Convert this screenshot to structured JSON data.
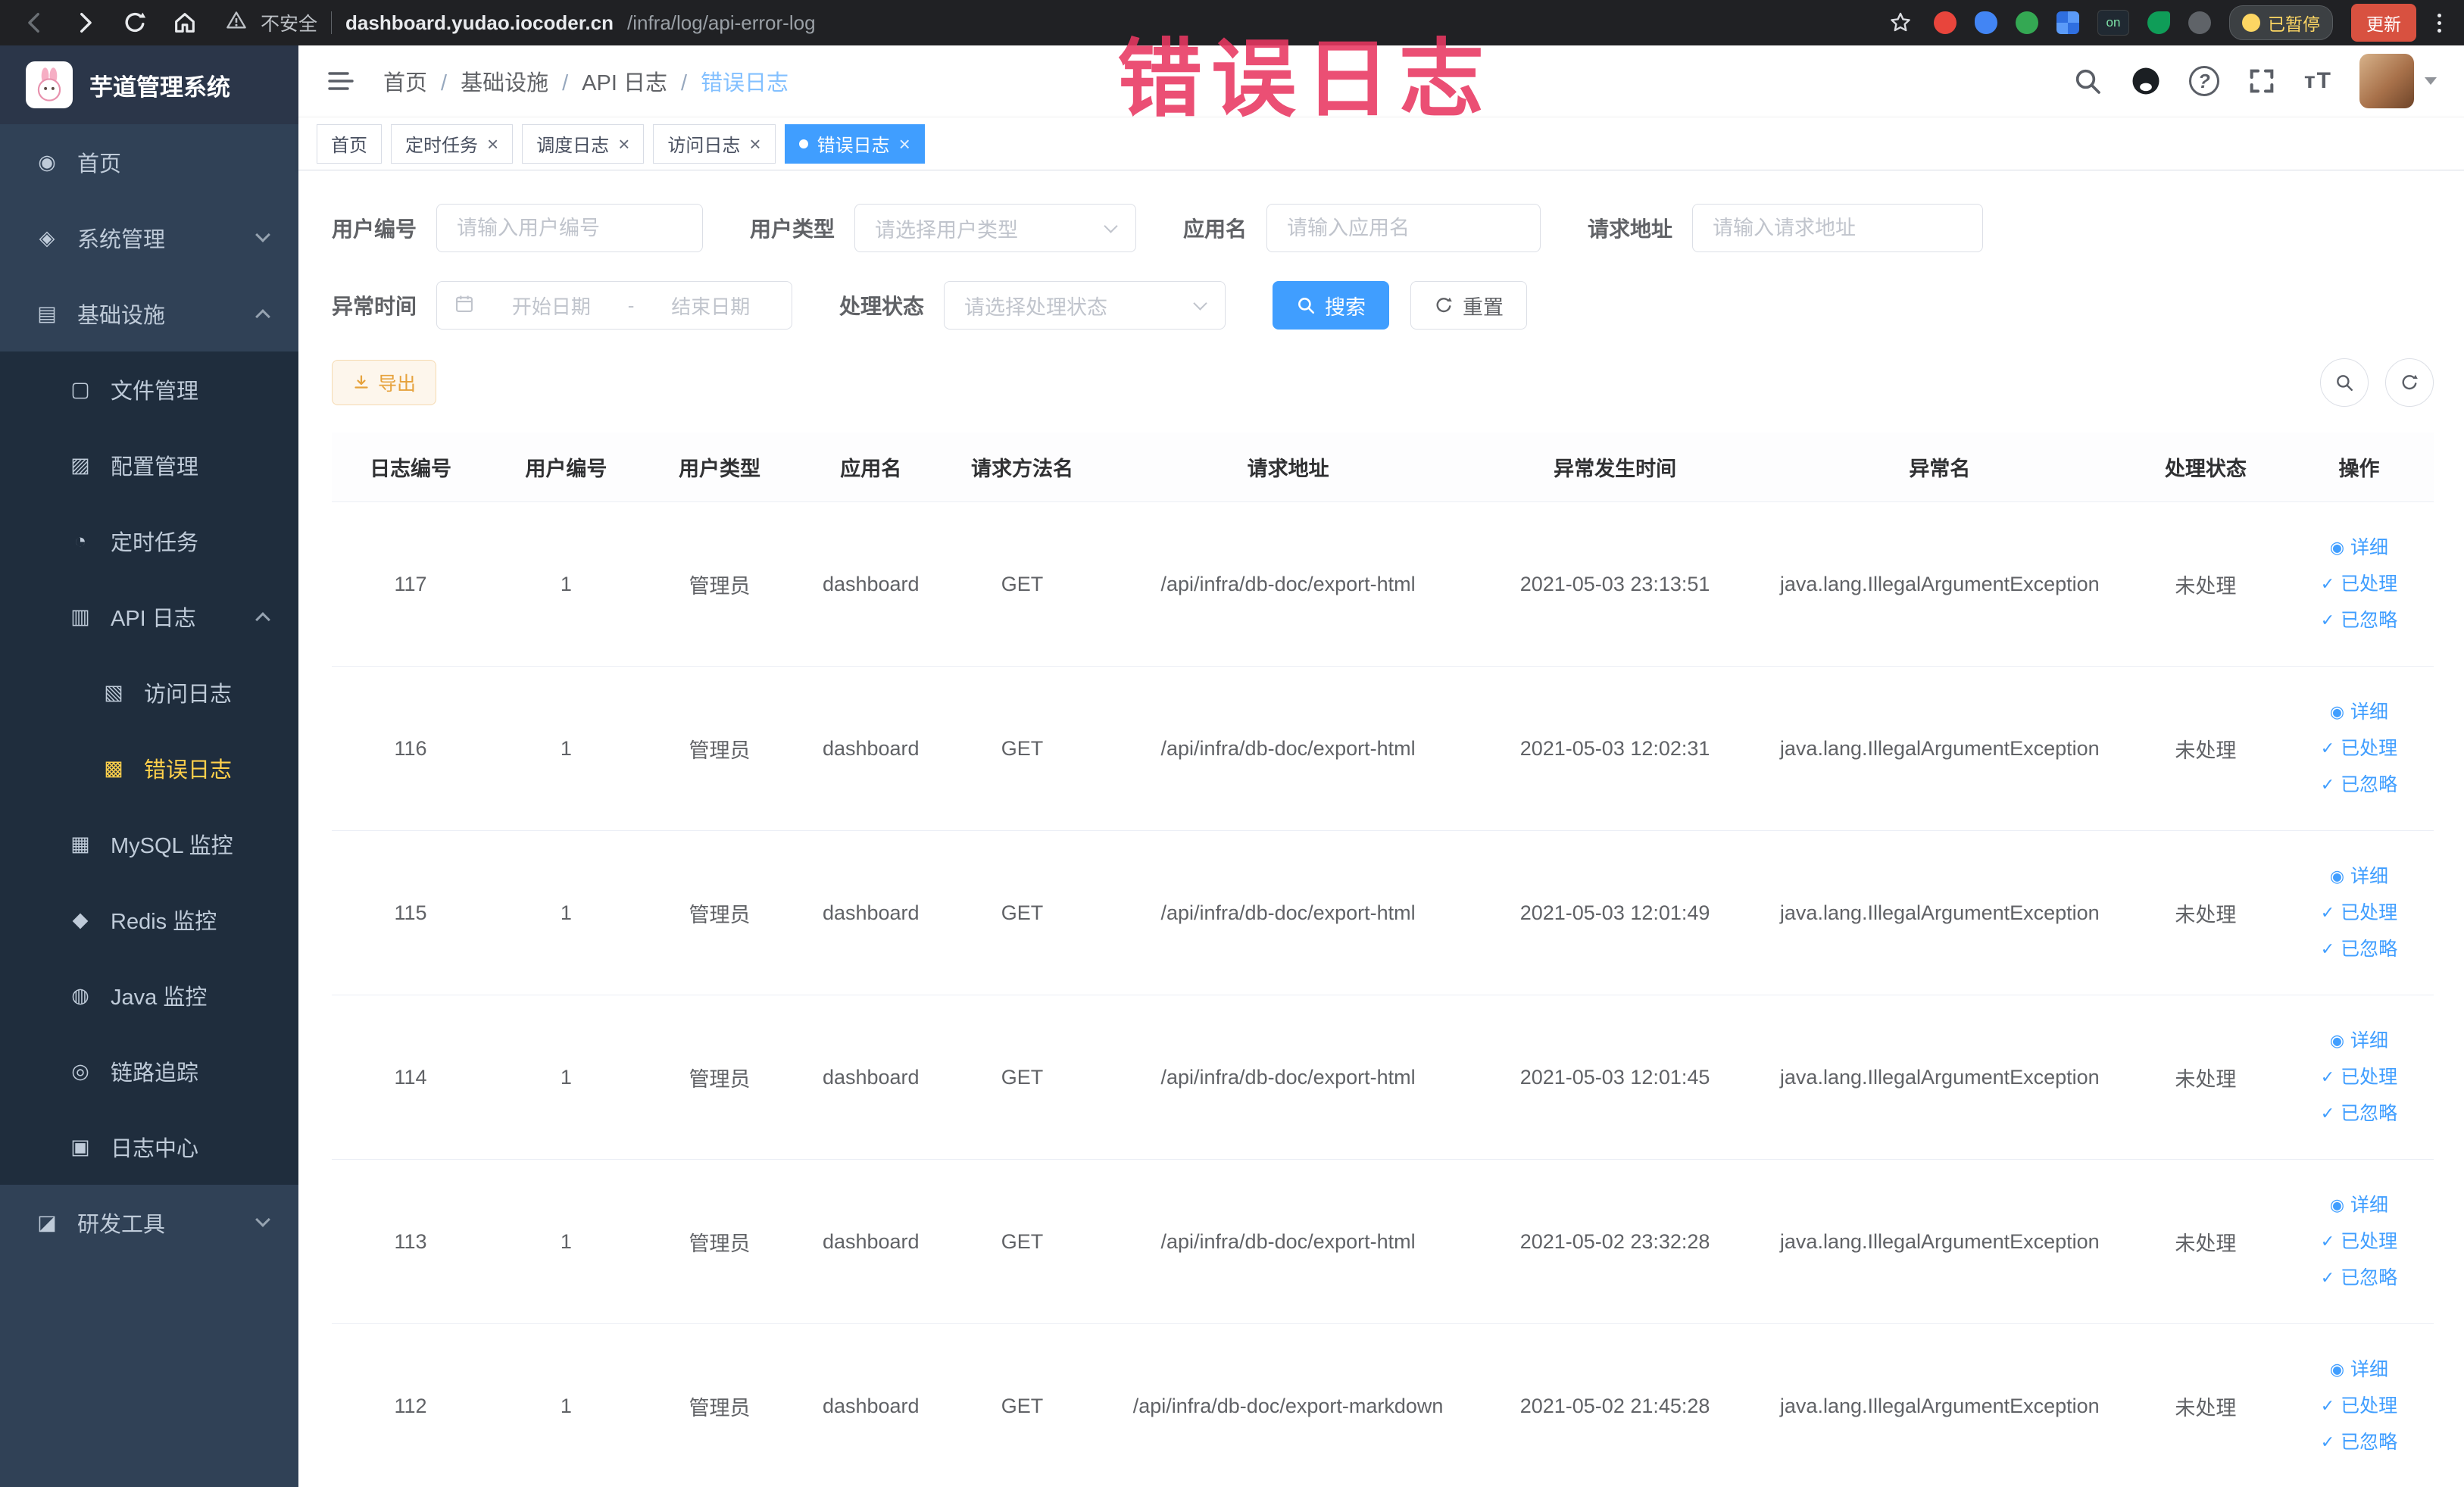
{
  "browser": {
    "security_label": "不安全",
    "url_host": "dashboard.yudao.iocoder.cn",
    "url_path": "/infra/log/api-error-log",
    "ext_on_label": "on",
    "paused_label": "已暂停",
    "update_label": "更新"
  },
  "watermark_text": "错误日志",
  "icons": {
    "close": "×",
    "question": "?",
    "font_size": "тT"
  },
  "sidebar": {
    "app_title": "芋道管理系统",
    "items": [
      {
        "label": "首页",
        "icon": "◉",
        "cls": "l0"
      },
      {
        "label": "系统管理",
        "icon": "◈",
        "cls": "l0",
        "arrow": "down"
      },
      {
        "label": "基础设施",
        "icon": "▤",
        "cls": "l0",
        "arrow": "up"
      },
      {
        "label": "文件管理",
        "icon": "▢",
        "cls": "l1"
      },
      {
        "label": "配置管理",
        "icon": "▨",
        "cls": "l1"
      },
      {
        "label": "定时任务",
        "icon": "◔",
        "cls": "l1"
      },
      {
        "label": "API 日志",
        "icon": "▥",
        "cls": "l1",
        "arrow": "up"
      },
      {
        "label": "访问日志",
        "icon": "▧",
        "cls": "l2"
      },
      {
        "label": "错误日志",
        "icon": "▩",
        "cls": "l2 active"
      },
      {
        "label": "MySQL 监控",
        "icon": "▦",
        "cls": "l1"
      },
      {
        "label": "Redis 监控",
        "icon": "◆",
        "cls": "l1"
      },
      {
        "label": "Java 监控",
        "icon": "◍",
        "cls": "l1"
      },
      {
        "label": "链路追踪",
        "icon": "◎",
        "cls": "l1"
      },
      {
        "label": "日志中心",
        "icon": "▣",
        "cls": "l1"
      },
      {
        "label": "研发工具",
        "icon": "◪",
        "cls": "l0",
        "arrow": "down"
      }
    ]
  },
  "header": {
    "breadcrumb": [
      {
        "label": "首页",
        "cls": ""
      },
      {
        "label": "基础设施",
        "cls": ""
      },
      {
        "label": "API 日志",
        "cls": ""
      },
      {
        "label": "错误日志",
        "cls": "current"
      }
    ]
  },
  "tabs": [
    {
      "label": "首页",
      "cls": "no-close"
    },
    {
      "label": "定时任务",
      "cls": ""
    },
    {
      "label": "调度日志",
      "cls": ""
    },
    {
      "label": "访问日志",
      "cls": ""
    },
    {
      "label": "错误日志",
      "cls": "active"
    }
  ],
  "filters": {
    "user_id_label": "用户编号",
    "user_id_placeholder": "请输入用户编号",
    "user_type_label": "用户类型",
    "user_type_placeholder": "请选择用户类型",
    "app_name_label": "应用名",
    "app_name_placeholder": "请输入应用名",
    "request_url_label": "请求地址",
    "request_url_placeholder": "请输入请求地址",
    "exception_time_label": "异常时间",
    "start_date_placeholder": "开始日期",
    "end_date_placeholder": "结束日期",
    "range_separator": "-",
    "process_status_label": "处理状态",
    "process_status_placeholder": "请选择处理状态",
    "search_label": "搜索",
    "reset_label": "重置"
  },
  "toolbar": {
    "export_label": "导出"
  },
  "table": {
    "columns": [
      {
        "label": "日志编号",
        "cls": "c-id"
      },
      {
        "label": "用户编号",
        "cls": "c-uid"
      },
      {
        "label": "用户类型",
        "cls": "c-utype"
      },
      {
        "label": "应用名",
        "cls": "c-app"
      },
      {
        "label": "请求方法名",
        "cls": "c-method"
      },
      {
        "label": "请求地址",
        "cls": "c-url"
      },
      {
        "label": "异常发生时间",
        "cls": "c-time"
      },
      {
        "label": "异常名",
        "cls": "c-exc"
      },
      {
        "label": "处理状态",
        "cls": "c-status"
      },
      {
        "label": "操作",
        "cls": "c-ops"
      }
    ],
    "actions": [
      {
        "icon": "◉",
        "label": "详细"
      },
      {
        "icon": "✓",
        "label": "已处理"
      },
      {
        "icon": "✓",
        "label": "已忽略"
      }
    ],
    "rows": [
      {
        "log_id": "117",
        "user_id": "1",
        "user_type": "管理员",
        "app": "dashboard",
        "method": "GET",
        "url": "/api/infra/db-doc/export-html",
        "time": "2021-05-03 23:13:51",
        "exception": "java.lang.IllegalArgumentException",
        "status": "未处理"
      },
      {
        "log_id": "116",
        "user_id": "1",
        "user_type": "管理员",
        "app": "dashboard",
        "method": "GET",
        "url": "/api/infra/db-doc/export-html",
        "time": "2021-05-03 12:02:31",
        "exception": "java.lang.IllegalArgumentException",
        "status": "未处理"
      },
      {
        "log_id": "115",
        "user_id": "1",
        "user_type": "管理员",
        "app": "dashboard",
        "method": "GET",
        "url": "/api/infra/db-doc/export-html",
        "time": "2021-05-03 12:01:49",
        "exception": "java.lang.IllegalArgumentException",
        "status": "未处理"
      },
      {
        "log_id": "114",
        "user_id": "1",
        "user_type": "管理员",
        "app": "dashboard",
        "method": "GET",
        "url": "/api/infra/db-doc/export-html",
        "time": "2021-05-03 12:01:45",
        "exception": "java.lang.IllegalArgumentException",
        "status": "未处理"
      },
      {
        "log_id": "113",
        "user_id": "1",
        "user_type": "管理员",
        "app": "dashboard",
        "method": "GET",
        "url": "/api/infra/db-doc/export-html",
        "time": "2021-05-02 23:32:28",
        "exception": "java.lang.IllegalArgumentException",
        "status": "未处理"
      },
      {
        "log_id": "112",
        "user_id": "1",
        "user_type": "管理员",
        "app": "dashboard",
        "method": "GET",
        "url": "/api/infra/db-doc/export-markdown",
        "time": "2021-05-02 21:45:28",
        "exception": "java.lang.IllegalArgumentException",
        "status": "未处理"
      }
    ]
  }
}
